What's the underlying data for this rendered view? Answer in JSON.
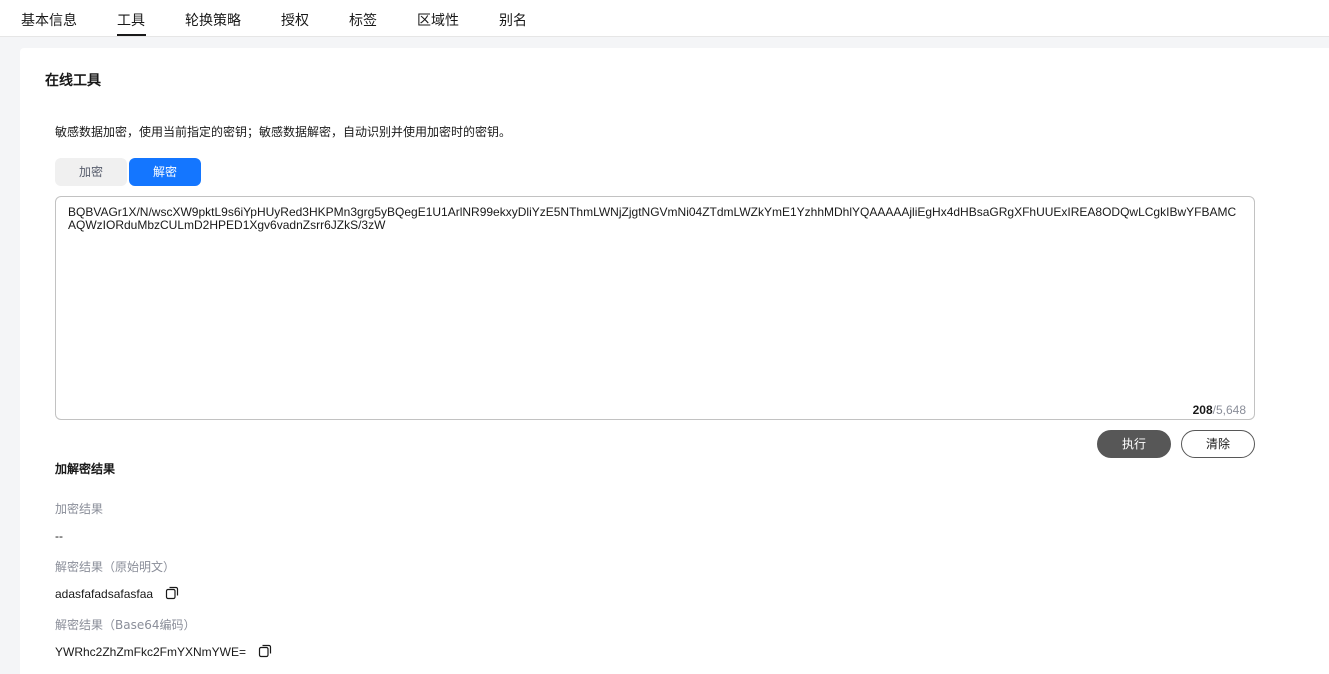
{
  "tabs": [
    {
      "label": "基本信息",
      "active": false
    },
    {
      "label": "工具",
      "active": true
    },
    {
      "label": "轮换策略",
      "active": false
    },
    {
      "label": "授权",
      "active": false
    },
    {
      "label": "标签",
      "active": false
    },
    {
      "label": "区域性",
      "active": false
    },
    {
      "label": "别名",
      "active": false
    }
  ],
  "online_tools": {
    "title": "在线工具",
    "description": "敏感数据加密，使用当前指定的密钥；敏感数据解密，自动识别并使用加密时的密钥。",
    "mode_options": {
      "encrypt": "加密",
      "decrypt": "解密"
    },
    "selected_mode": "解密",
    "input_text": "BQBVAGr1X/N/wscXW9pktL9s6iYpHUyRed3HKPMn3grg5yBQegE1U1ArlNR99ekxyDliYzE5NThmLWNjZjgtNGVmNi04ZTdmLWZkYmE1YzhhMDhlYQAAAAAjliEgHx4dHBsaGRgXFhUUExIREA8ODQwLCgkIBwYFBAMCAQWzIORduMbzCULmD2HPED1Xgv6vadnZsrr6JZkS/3zW",
    "char_count": "208",
    "char_limit": "/5,648",
    "run_label": "执行",
    "clear_label": "清除"
  },
  "results": {
    "title": "加解密结果",
    "encrypt_result_label": "加密结果",
    "encrypt_result_value": "--",
    "decrypt_plain_label": "解密结果（原始明文）",
    "decrypt_plain_value": "adasfafadsafasfaa",
    "decrypt_base64_label": "解密结果（Base64编码）",
    "decrypt_base64_value": "YWRhc2ZhZmFkc2FmYXNmYWE="
  },
  "colors": {
    "primary": "#1476ff",
    "run_button": "#575757",
    "label_gray": "#8a8e99"
  },
  "icons": {
    "copy": "copy-icon"
  }
}
